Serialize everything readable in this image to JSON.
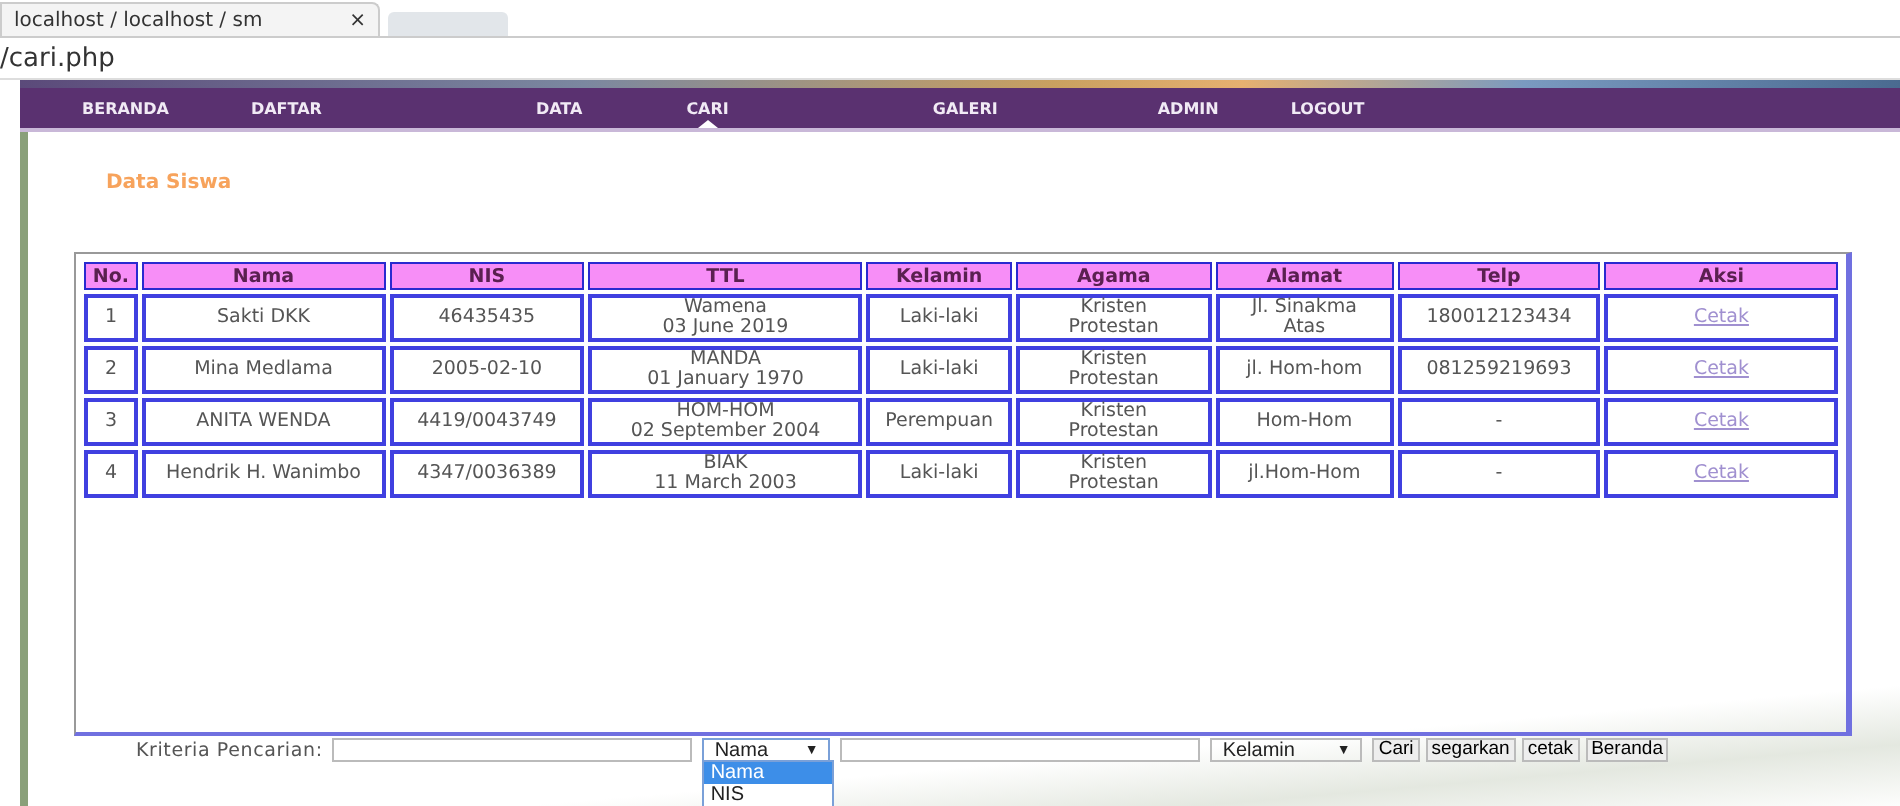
{
  "browser": {
    "tab_title": "localhost / localhost / sm",
    "tab_close": "×",
    "address": "/cari.php"
  },
  "nav": [
    {
      "label": "BERANDA",
      "selected": false
    },
    {
      "label": "DAFTAR",
      "selected": false
    },
    {
      "label": "DATA",
      "selected": false
    },
    {
      "label": "CARI",
      "selected": true
    },
    {
      "label": "GALERI",
      "selected": false
    },
    {
      "label": "ADMIN",
      "selected": false
    },
    {
      "label": "LOGOUT",
      "selected": false
    }
  ],
  "heading": "Data Siswa",
  "table": {
    "columns": [
      "No.",
      "Nama",
      "NIS",
      "TTL",
      "Kelamin",
      "Agama",
      "Alamat",
      "Telp",
      "Aksi"
    ],
    "rows": [
      {
        "no": "1",
        "nama": "Sakti DKK",
        "nis": "46435435",
        "ttl": [
          "Wamena",
          "03 June 2019"
        ],
        "kelamin": "Laki-laki",
        "agama": [
          "Kristen",
          "Protestan"
        ],
        "alamat": [
          "Jl. Sinakma",
          "Atas"
        ],
        "telp": "180012123434",
        "aksi": "Cetak"
      },
      {
        "no": "2",
        "nama": "Mina Medlama",
        "nis": "2005-02-10",
        "ttl": [
          "MANDA",
          "01 January 1970"
        ],
        "kelamin": "Laki-laki",
        "agama": [
          "Kristen",
          "Protestan"
        ],
        "alamat": [
          "jl. Hom-hom"
        ],
        "telp": "081259219693",
        "aksi": "Cetak"
      },
      {
        "no": "3",
        "nama": "ANITA WENDA",
        "nis": "4419/0043749",
        "ttl": [
          "HOM-HOM",
          "02 September 2004"
        ],
        "kelamin": "Perempuan",
        "agama": [
          "Kristen",
          "Protestan"
        ],
        "alamat": [
          "Hom-Hom"
        ],
        "telp": "-",
        "aksi": "Cetak"
      },
      {
        "no": "4",
        "nama": "Hendrik H. Wanimbo",
        "nis": "4347/0036389",
        "ttl": [
          "BIAK",
          "11 March 2003"
        ],
        "kelamin": "Laki-laki",
        "agama": [
          "Kristen",
          "Protestan"
        ],
        "alamat": [
          "jl.Hom-Hom"
        ],
        "telp": "-",
        "aksi": "Cetak"
      }
    ]
  },
  "search": {
    "label": "Kriteria Pencarian:",
    "select": {
      "value": "Nama",
      "arrow": "▼",
      "expanded": true,
      "options": [
        {
          "label": "Nama",
          "selected": true
        },
        {
          "label": "NIS",
          "selected": false
        }
      ]
    },
    "select2": {
      "value": "Kelamin",
      "arrow": "▼"
    },
    "buttons": [
      "Cari",
      "segarkan",
      "cetak",
      "Beranda"
    ]
  }
}
